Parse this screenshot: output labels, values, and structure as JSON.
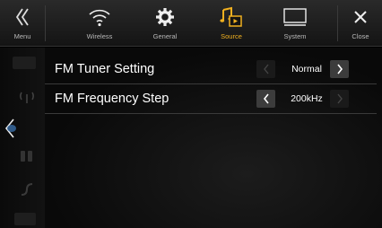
{
  "tabs": [
    {
      "label": "Menu",
      "icon": "menu-back-icon",
      "active": false
    },
    {
      "label": "Wireless",
      "icon": "wireless-icon",
      "active": false
    },
    {
      "label": "General",
      "icon": "gear-icon",
      "active": false
    },
    {
      "label": "Source",
      "icon": "source-music-icon",
      "active": true
    },
    {
      "label": "System",
      "icon": "system-monitor-icon",
      "active": false
    },
    {
      "label": "Close",
      "icon": "close-icon",
      "active": false
    }
  ],
  "settings": [
    {
      "label": "FM Tuner Setting",
      "value": "Normal"
    },
    {
      "label": "FM Frequency Step",
      "value": "200kHz"
    }
  ],
  "colors": {
    "accent": "#f0b020",
    "text": "#ffffff",
    "muted": "#b8b8b8"
  }
}
